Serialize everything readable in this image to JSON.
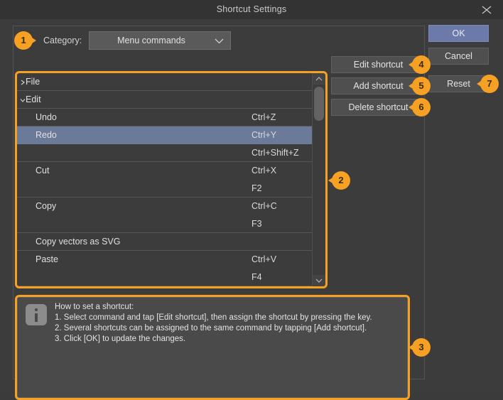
{
  "window": {
    "title": "Shortcut Settings",
    "close_icon": "close-icon"
  },
  "category": {
    "label": "Category:",
    "selected": "Menu commands",
    "chevron_icon": "chevron-down-icon"
  },
  "list": {
    "rows": [
      {
        "name": "File",
        "key": "",
        "level": "cat",
        "marker": "chevron-right-icon",
        "separator": true,
        "selected": false
      },
      {
        "name": "Edit",
        "key": "",
        "level": "cat",
        "marker": "chevron-down-icon",
        "separator": true,
        "selected": false
      },
      {
        "name": "Undo",
        "key": "Ctrl+Z",
        "level": "cmd",
        "marker": "",
        "separator": true,
        "selected": false
      },
      {
        "name": "Redo",
        "key": "Ctrl+Y",
        "level": "cmd",
        "marker": "",
        "separator": false,
        "selected": true
      },
      {
        "name": "",
        "key": "Ctrl+Shift+Z",
        "level": "cmd",
        "marker": "",
        "separator": true,
        "selected": false
      },
      {
        "name": "Cut",
        "key": "Ctrl+X",
        "level": "cmd",
        "marker": "",
        "separator": false,
        "selected": false
      },
      {
        "name": "",
        "key": "F2",
        "level": "cmd",
        "marker": "",
        "separator": true,
        "selected": false
      },
      {
        "name": "Copy",
        "key": "Ctrl+C",
        "level": "cmd",
        "marker": "",
        "separator": false,
        "selected": false
      },
      {
        "name": "",
        "key": "F3",
        "level": "cmd",
        "marker": "",
        "separator": true,
        "selected": false
      },
      {
        "name": "Copy vectors as SVG",
        "key": "",
        "level": "cmd",
        "marker": "",
        "separator": true,
        "selected": false
      },
      {
        "name": "Paste",
        "key": "Ctrl+V",
        "level": "cmd",
        "marker": "",
        "separator": false,
        "selected": false
      },
      {
        "name": "",
        "key": "F4",
        "level": "cmd",
        "marker": "",
        "separator": true,
        "selected": false
      }
    ],
    "scrollbar": {
      "up_icon": "chevron-up-icon",
      "down_icon": "chevron-down-icon"
    }
  },
  "info": {
    "icon": "info-icon",
    "lines": [
      "How to set a shortcut:",
      "1. Select command and tap [Edit shortcut], then assign the shortcut by pressing the key.",
      "2. Several shortcuts can be assigned to the same command by tapping [Add shortcut].",
      "3. Click [OK] to update the changes."
    ]
  },
  "buttons": {
    "edit_shortcut": "Edit shortcut",
    "add_shortcut": "Add shortcut",
    "delete_shortcut": "Delete shortcut",
    "ok": "OK",
    "cancel": "Cancel",
    "reset": "Reset"
  },
  "callouts": [
    {
      "number": "1",
      "target": "category-row"
    },
    {
      "number": "2",
      "target": "shortcut-list"
    },
    {
      "number": "3",
      "target": "info-box"
    },
    {
      "number": "4",
      "target": "edit-shortcut-button"
    },
    {
      "number": "5",
      "target": "add-shortcut-button"
    },
    {
      "number": "6",
      "target": "delete-shortcut-button"
    },
    {
      "number": "7",
      "target": "reset-button"
    }
  ],
  "colors": {
    "accent": "#f6a024",
    "selection": "#6b7a99",
    "ok_button": "#6b7aa8",
    "window_bg": "#3c3c3c",
    "titlebar_bg": "#333333"
  }
}
